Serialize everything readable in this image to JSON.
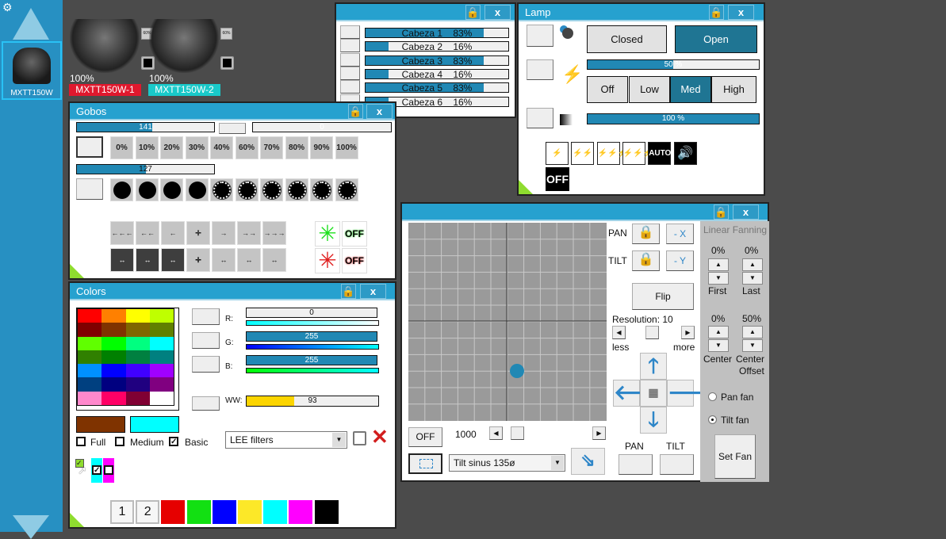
{
  "sidebar": {
    "selected_fixture": "MXTT150W",
    "colors": {
      "bg": "#2790c2",
      "selected_border": "#29c2f5"
    }
  },
  "fixtures": [
    {
      "name": "MXTT150W-1",
      "intensity": "100%",
      "badge": "60%",
      "tag_color": "#e0182d"
    },
    {
      "name": "MXTT150W-2",
      "intensity": "100%",
      "badge": "60%",
      "tag_color": "#19c9c9"
    }
  ],
  "heads": {
    "rows": [
      {
        "label": "Cabeza 1",
        "value": "83%",
        "level": 0.83
      },
      {
        "label": "Cabeza 2",
        "value": "16%",
        "level": 0.16
      },
      {
        "label": "Cabeza 3",
        "value": "83%",
        "level": 0.83
      },
      {
        "label": "Cabeza 4",
        "value": "16%",
        "level": 0.16
      },
      {
        "label": "Cabeza 5",
        "value": "83%",
        "level": 0.83
      },
      {
        "label": "Cabeza 6",
        "value": "16%",
        "level": 0.16
      }
    ]
  },
  "lamp": {
    "title": "Lamp",
    "closed": "Closed",
    "open": "Open",
    "dimmer_value": "50 %",
    "dimmer_level": 0.5,
    "modes": [
      "Off",
      "Low",
      "Med",
      "High"
    ],
    "active_mode": "Med",
    "master_value": "100 %",
    "master_level": 1.0,
    "icons": [
      "strobe-slow-icon",
      "strobe-medium-icon",
      "strobe-fast-icon",
      "strobe-off-icon",
      "auto-icon",
      "sound-icon"
    ],
    "auto": "AUTO",
    "off": "OFF"
  },
  "gobos": {
    "title": "Gobos",
    "bar1_value": "141",
    "bar1_level": 0.55,
    "bar2_value": "0",
    "bar3_value": "127",
    "bar3_level": 0.5,
    "percents": [
      "0%",
      "10%",
      "20%",
      "30%",
      "40%",
      "60%",
      "70%",
      "80%",
      "90%",
      "100%"
    ],
    "off": "OFF"
  },
  "colors": {
    "title": "Colors",
    "palette": [
      "#ff0000",
      "#ff8000",
      "#ffff00",
      "#bfff00",
      "#800000",
      "#803300",
      "#806600",
      "#608000",
      "#60ff00",
      "#00ff00",
      "#00ff80",
      "#00ffff",
      "#308000",
      "#008000",
      "#008040",
      "#008080",
      "#0090ff",
      "#0000ff",
      "#4000ff",
      "#a000ff",
      "#004080",
      "#000080",
      "#200080",
      "#800080",
      "#ff88cc",
      "#ff0066",
      "#800033",
      "#ffffff"
    ],
    "r_label": "R:",
    "g_label": "G:",
    "b_label": "B:",
    "ww_label": "WW:",
    "r_value": "0",
    "g_value": "255",
    "b_value": "255",
    "ww_value": "93",
    "ww_level": 0.36,
    "current_color": "#7f3300",
    "target_color": "#00ffff",
    "full": "Full",
    "medium": "Medium",
    "basic": "Basic",
    "filter_select": "LEE filters",
    "swatches": [
      "1",
      "2",
      "#e60000",
      "#12e012",
      "#0000ff",
      "#fce828",
      "#00ffff",
      "#ff00ff",
      "#000000"
    ]
  },
  "position": {
    "pan": "PAN",
    "tilt": "TILT",
    "minus_x": "- X",
    "minus_y": "- Y",
    "flip": "Flip",
    "resolution": "Resolution: 10",
    "less": "less",
    "more": "more",
    "off": "OFF",
    "speed": "1000",
    "effect": "Tilt sinus 135ø",
    "pan_btn": "PAN",
    "tilt_btn": "TILT",
    "fanning_title": "Linear Fanning",
    "first_value": "0%",
    "last_value": "0%",
    "first": "First",
    "last": "Last",
    "center_value": "0%",
    "offset_value": "50%",
    "center": "Center",
    "center2": "Center",
    "offset": "Offset",
    "pan_fan": "Pan fan",
    "tilt_fan": "Tilt fan",
    "set_fan": "Set Fan",
    "dot_color": "#2188b4"
  }
}
